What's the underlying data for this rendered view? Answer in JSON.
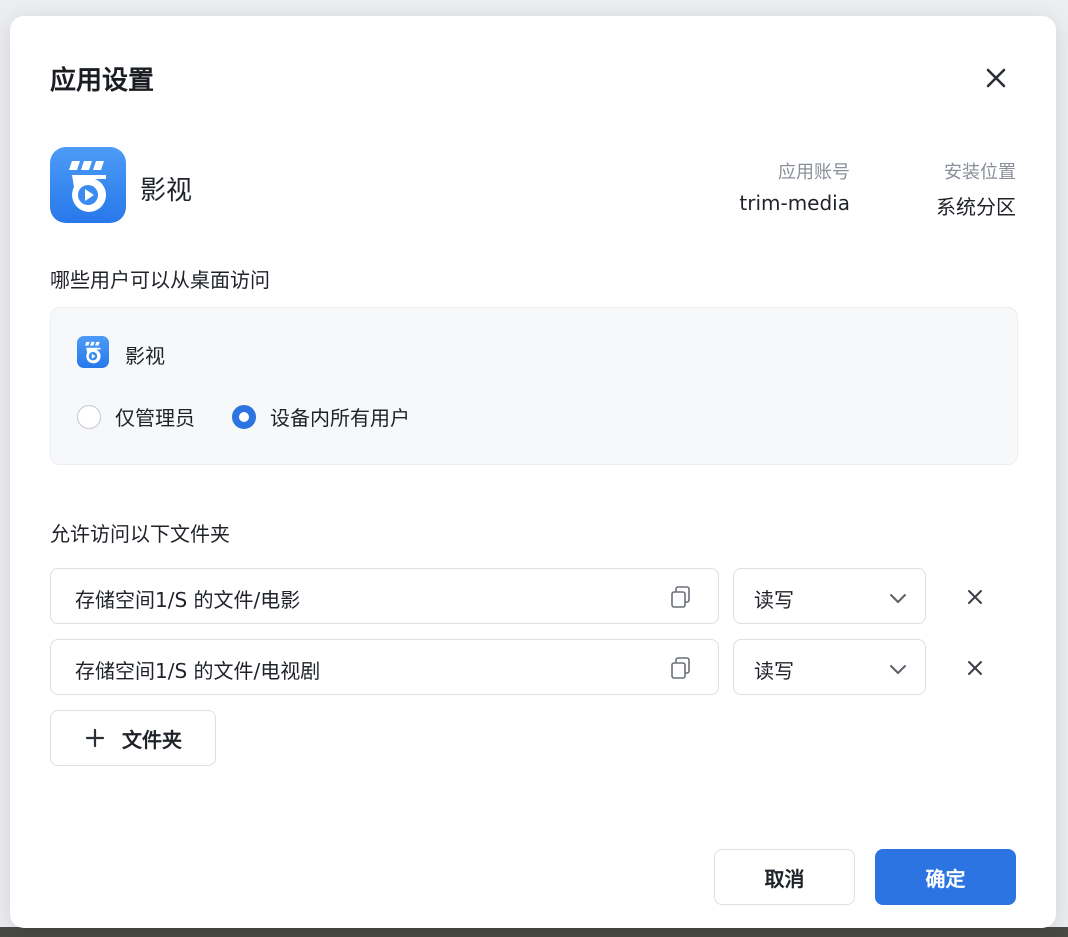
{
  "dialog": {
    "title": "应用设置",
    "close_icon": "close-icon"
  },
  "app": {
    "name": "影视",
    "icon": "media-app-icon",
    "account_label": "应用账号",
    "account_value": "trim-media",
    "location_label": "安装位置",
    "location_value": "系统分区"
  },
  "desktop_access": {
    "title": "哪些用户可以从桌面访问",
    "app_name": "影视",
    "options": [
      {
        "label": "仅管理员",
        "selected": false
      },
      {
        "label": "设备内所有用户",
        "selected": true
      }
    ]
  },
  "folders": {
    "title": "允许访问以下文件夹",
    "items": [
      {
        "path": "存储空间1/S 的文件/电影",
        "permission": "读写"
      },
      {
        "path": "存储空间1/S 的文件/电视剧",
        "permission": "读写"
      }
    ],
    "add_label": "文件夹"
  },
  "footer": {
    "cancel_label": "取消",
    "ok_label": "确定"
  },
  "colors": {
    "accent": "#2d74e3",
    "app_icon": "#3a8af0"
  }
}
